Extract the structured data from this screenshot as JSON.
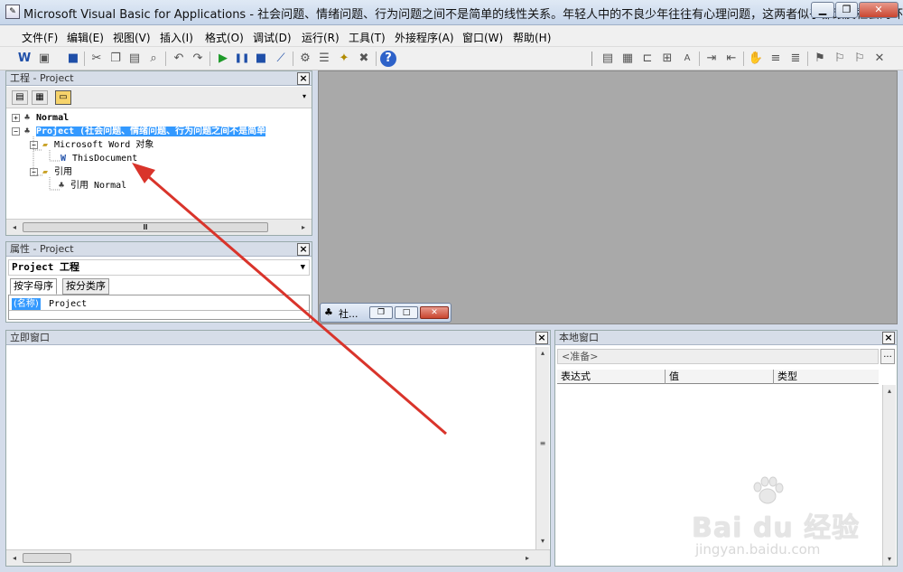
{
  "window": {
    "title": "Microsoft Visual Basic for Applications - 社会问题、情绪问题、行为问题之间不是简单的线性关系。年轻人中的不良少年往往有心理问题，这两者似乎都跟反社会的环境..."
  },
  "menu": [
    "文件(F)",
    "编辑(E)",
    "视图(V)",
    "插入(I)",
    "格式(O)",
    "调试(D)",
    "运行(R)",
    "工具(T)",
    "外接程序(A)",
    "窗口(W)",
    "帮助(H)"
  ],
  "project_panel": {
    "title": "工程 - Project",
    "tree": {
      "normal": "Normal",
      "project": "Project (社会问题、情绪问题、行为问题之间不是简单",
      "word_objects": "Microsoft Word 对象",
      "this_document": "ThisDocument",
      "references": "引用",
      "ref_normal": "引用 Normal"
    },
    "hscroll_grip": "Ⅲ"
  },
  "properties_panel": {
    "title": "属性 - Project",
    "selected_object": "Project 工程",
    "tabs": [
      "按字母序",
      "按分类序"
    ],
    "name_key": "(名称)",
    "name_value": "Project"
  },
  "minimized_doc": {
    "label": "社..."
  },
  "immediate_panel": {
    "title": "立即窗口"
  },
  "locals_panel": {
    "title": "本地窗口",
    "status": "<准备>",
    "dots": "...",
    "columns": [
      "表达式",
      "值",
      "类型"
    ]
  },
  "watermark": {
    "brand": "Bai du 经验",
    "url": "jingyan.baidu.com"
  },
  "colors": {
    "selection": "#3399ff",
    "arrow": "#d9342b",
    "workspace": "#a9a9a9"
  }
}
